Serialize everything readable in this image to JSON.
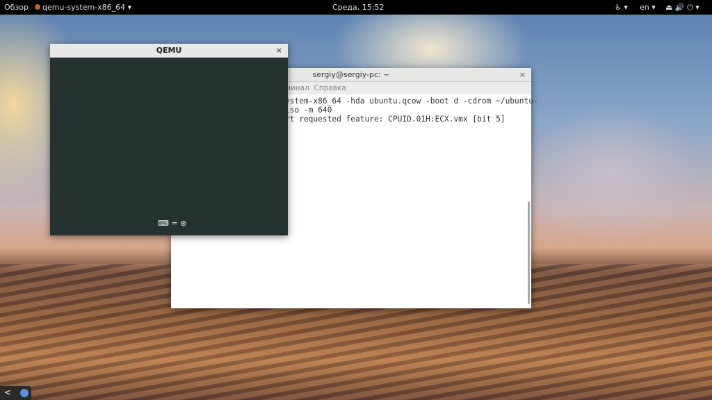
{
  "topbar": {
    "activities": "Обзор",
    "app_menu": "qemu-system-x86_64 ▾",
    "clock": "Среда, 15:52",
    "accessibility": "♿ ▾",
    "language": "en ▾",
    "status_icons": "⏏ 🔊 ⏻ ▾"
  },
  "terminal": {
    "title": "sergiy@sergiy-pc: ~",
    "menu_visible": "минал",
    "menu_help": "Справка",
    "lines": [
      "ystem-x86_64 -hda ubuntu.qcow -boot d -cdrom ~/ubuntu-",
      "iso -m 640",
      "rt requested feature: CPUID.01H:ECX.vmx [bit 5]"
    ],
    "close": "×"
  },
  "qemu": {
    "title": "QEMU",
    "close": "×",
    "status": "⌨ = ⊛"
  },
  "dock": {
    "back": "<"
  }
}
